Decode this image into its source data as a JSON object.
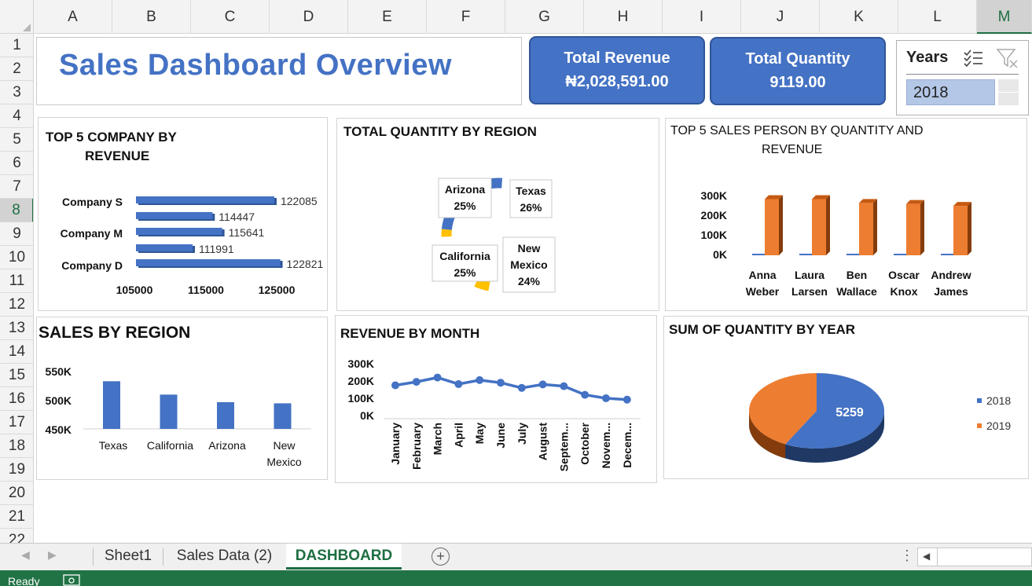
{
  "columns": [
    "A",
    "B",
    "C",
    "D",
    "E",
    "F",
    "G",
    "H",
    "I",
    "J",
    "K",
    "L",
    "M"
  ],
  "selected_column": "M",
  "rows": [
    "1",
    "2",
    "3",
    "4",
    "5",
    "6",
    "7",
    "8",
    "9",
    "10",
    "11",
    "12",
    "13",
    "14",
    "15",
    "16",
    "17",
    "18",
    "19",
    "20",
    "21",
    "22"
  ],
  "selected_row": "8",
  "dashboard_title": "Sales Dashboard Overview",
  "kpis": {
    "revenue_label": "Total Revenue",
    "revenue_value": "₦2,028,591.00",
    "quantity_label": "Total Quantity",
    "quantity_value": "9119.00"
  },
  "slicer": {
    "title": "Years",
    "selected": "2018",
    "icons": [
      "multi-select-icon",
      "clear-filter-icon"
    ]
  },
  "charts": {
    "top_company": {
      "title_line1": "TOP 5 COMPANY BY",
      "title_line2": "REVENUE",
      "color": "#4472c4",
      "category_labels": [
        "Company S",
        "Company M",
        "Company D"
      ]
    },
    "region_donut": {
      "title": "TOTAL QUANTITY BY REGION"
    },
    "top_salesperson": {
      "title_line1": "TOP 5 SALES PERSON BY QUANTITY AND",
      "title_line2": "REVENUE",
      "colors": {
        "quantity": "#4472c4",
        "revenue": "#ed7d31"
      }
    },
    "sales_region": {
      "title": "SALES BY REGION",
      "color": "#4472c4"
    },
    "revenue_month": {
      "title": "REVENUE BY MONTH",
      "color": "#4472c4"
    },
    "quantity_year": {
      "title": "SUM OF QUANTITY BY YEAR",
      "label": "5259"
    }
  },
  "chart_data": [
    {
      "type": "bar",
      "orientation": "horizontal",
      "values": [
        122085,
        114447,
        115641,
        111991,
        122821
      ],
      "category_labels": [
        "Company S",
        "Company M",
        "Company D"
      ],
      "xlim": [
        105000,
        125000
      ],
      "xticks": [
        "105000",
        "115000",
        "125000"
      ]
    },
    {
      "type": "pie",
      "style": "doughnut",
      "labels": [
        "Arizona",
        "Texas",
        "New Mexico",
        "California"
      ],
      "pct_labels": [
        "25%",
        "26%",
        "24%",
        "25%"
      ],
      "colors": [
        "#ffc000",
        "#4472c4",
        "#ed7d31",
        "#a5a5a5"
      ]
    },
    {
      "type": "bar",
      "style": "3d-column",
      "categories": [
        [
          "Anna",
          "Weber"
        ],
        [
          "Laura",
          "Larsen"
        ],
        [
          "Ben",
          "Wallace"
        ],
        [
          "Oscar",
          "Knox"
        ],
        [
          "Andrew",
          "James"
        ]
      ],
      "series": [
        {
          "values": [
            8,
            8,
            7,
            7,
            7
          ],
          "color": "#4472c4"
        },
        {
          "values": [
            290000,
            290000,
            270000,
            265000,
            255000
          ],
          "color": "#ed7d31"
        }
      ],
      "ylim": [
        0,
        300000
      ],
      "yticks": [
        "0K",
        "100K",
        "200K",
        "300K"
      ]
    },
    {
      "type": "bar",
      "categories": [
        [
          "Texas"
        ],
        [
          "California"
        ],
        [
          "Arizona"
        ],
        [
          "New",
          "Mexico"
        ]
      ],
      "values": [
        532000,
        509000,
        496000,
        494000
      ],
      "ylim": [
        450000,
        550000
      ],
      "yticks": [
        "450K",
        "500K",
        "550K"
      ]
    },
    {
      "type": "line",
      "categories": [
        "January",
        "February",
        "March",
        "April",
        "May",
        "June",
        "July",
        "August",
        "Septem...",
        "October",
        "Novem...",
        "Decem..."
      ],
      "values": [
        175000,
        195000,
        220000,
        182000,
        205000,
        190000,
        160000,
        180000,
        170000,
        120000,
        100000,
        92000
      ],
      "ylim": [
        0,
        300000
      ],
      "yticks": [
        "0K",
        "100K",
        "200K",
        "300K"
      ]
    },
    {
      "type": "pie",
      "style": "3d",
      "legend": [
        "2018",
        "2019"
      ],
      "values": [
        5259,
        3860
      ],
      "colors": [
        "#4472c4",
        "#ed7d31"
      ],
      "data_label": "5259",
      "legend_position": "right"
    }
  ],
  "sheet_tabs": [
    "Sheet1",
    "Sales Data (2)",
    "DASHBOARD"
  ],
  "active_tab": "DASHBOARD",
  "status": "Ready"
}
